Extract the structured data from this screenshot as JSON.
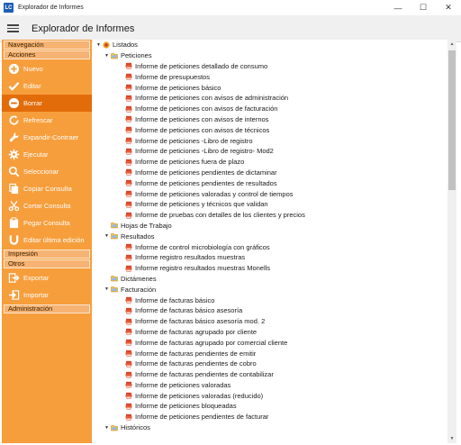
{
  "window": {
    "app_icon": "LC",
    "title": "Explorador de Informes",
    "controls": [
      "—",
      "☐",
      "✕"
    ]
  },
  "header": {
    "title": "Explorador de Informes"
  },
  "sidebar": {
    "sections": [
      {
        "label": "Navegación"
      },
      {
        "label": "Acciones"
      },
      {
        "label": "Impresión"
      },
      {
        "label": "Otros"
      },
      {
        "label": "Administración"
      }
    ],
    "actions": [
      {
        "label": "Nuevo",
        "icon": "plus-circle-icon",
        "selected": false
      },
      {
        "label": "Editar",
        "icon": "checkmark-icon",
        "selected": false
      },
      {
        "label": "Borrar",
        "icon": "minus-circle-icon",
        "selected": true
      },
      {
        "label": "Refrescar",
        "icon": "refresh-icon",
        "selected": false
      },
      {
        "label": "Expandir-Contraer",
        "icon": "wrench-icon",
        "selected": false
      },
      {
        "label": "Ejecutar",
        "icon": "gear-icon",
        "selected": false
      },
      {
        "label": "Seleccionar",
        "icon": "search-icon",
        "selected": false
      },
      {
        "label": "Copiar Consulta",
        "icon": "copy-icon",
        "selected": false
      },
      {
        "label": "Cortar Consulta",
        "icon": "scissors-icon",
        "selected": false
      },
      {
        "label": "Pegar Consulta",
        "icon": "paste-icon",
        "selected": false
      },
      {
        "label": "Editar última edición",
        "icon": "magnet-icon",
        "selected": false
      }
    ],
    "other_actions": [
      {
        "label": "Exportar",
        "icon": "export-icon"
      },
      {
        "label": "Importar",
        "icon": "import-icon"
      }
    ]
  },
  "tree": [
    {
      "level": 0,
      "type": "root",
      "label": "Listados"
    },
    {
      "level": 1,
      "type": "folder",
      "label": "Peticiones"
    },
    {
      "level": 2,
      "type": "report",
      "label": "Informe de peticiones detallado de consumo"
    },
    {
      "level": 2,
      "type": "report",
      "label": "Informe de presupuestos"
    },
    {
      "level": 2,
      "type": "report",
      "label": "Informe de peticiones básico"
    },
    {
      "level": 2,
      "type": "report",
      "label": "Informe de peticiones con avisos de administración"
    },
    {
      "level": 2,
      "type": "report",
      "label": "Informe de peticiones con avisos de facturación"
    },
    {
      "level": 2,
      "type": "report",
      "label": "Informe de peticiones con avisos de internos"
    },
    {
      "level": 2,
      "type": "report",
      "label": "Informe de peticiones con avisos de técnicos"
    },
    {
      "level": 2,
      "type": "report",
      "label": "Informe de peticiones -Libro de registro"
    },
    {
      "level": 2,
      "type": "report",
      "label": "Informe de peticiones -Libro de registro- Mod2"
    },
    {
      "level": 2,
      "type": "report",
      "label": "Informe de peticiones fuera de plazo"
    },
    {
      "level": 2,
      "type": "report",
      "label": "Informe de peticiones pendientes de dictaminar"
    },
    {
      "level": 2,
      "type": "report",
      "label": "Informe de peticiones pendientes de resultados"
    },
    {
      "level": 2,
      "type": "report",
      "label": "Informe de peticiones valoradas y control de tiempos"
    },
    {
      "level": 2,
      "type": "report",
      "label": "Informe de peticiones y técnicos que validan"
    },
    {
      "level": 2,
      "type": "report",
      "label": "Informe de pruebas con detalles de los clientes y precios"
    },
    {
      "level": 1,
      "type": "folder-empty",
      "label": "Hojas de Trabajo"
    },
    {
      "level": 1,
      "type": "folder",
      "label": "Resultados"
    },
    {
      "level": 2,
      "type": "report",
      "label": "Informe de control microbiología con gráficos"
    },
    {
      "level": 2,
      "type": "report",
      "label": "Informe registro resultados muestras"
    },
    {
      "level": 2,
      "type": "report",
      "label": "Informe registro resultados muestras Monells"
    },
    {
      "level": 1,
      "type": "folder-empty",
      "label": "Dictámenes"
    },
    {
      "level": 1,
      "type": "folder",
      "label": "Facturación"
    },
    {
      "level": 2,
      "type": "report",
      "label": "Informe de facturas básico"
    },
    {
      "level": 2,
      "type": "report",
      "label": "Informe de facturas básico asesoría"
    },
    {
      "level": 2,
      "type": "report",
      "label": "Informe de facturas básico asesoría mod. 2"
    },
    {
      "level": 2,
      "type": "report",
      "label": "Informe de facturas agrupado por cliente"
    },
    {
      "level": 2,
      "type": "report",
      "label": "Informe de facturas agrupado por comercial cliente"
    },
    {
      "level": 2,
      "type": "report",
      "label": "Informe de facturas pendientes de emitir"
    },
    {
      "level": 2,
      "type": "report",
      "label": "Informe de facturas pendientes de cobro"
    },
    {
      "level": 2,
      "type": "report",
      "label": "Informe de facturas pendientes de contabilizar"
    },
    {
      "level": 2,
      "type": "report",
      "label": "Informe de peticiones valoradas"
    },
    {
      "level": 2,
      "type": "report",
      "label": "Informe de peticiones valoradas (reducido)"
    },
    {
      "level": 2,
      "type": "report",
      "label": "Informe de peticiones bloqueadas"
    },
    {
      "level": 2,
      "type": "report",
      "label": "Informe de peticiones pendientes de facturar"
    },
    {
      "level": 1,
      "type": "folder",
      "label": "Históricos"
    }
  ],
  "colors": {
    "sidebar_bg": "#f79e3c",
    "sidebar_selected": "#e36c0a",
    "report_icon": "#d9462a"
  }
}
